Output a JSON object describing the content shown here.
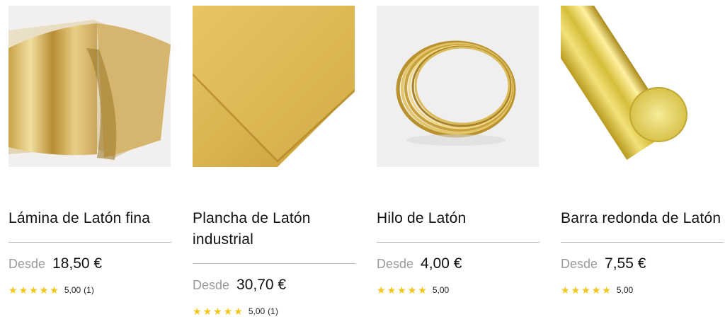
{
  "products": [
    {
      "title": "Lámina de Latón fina",
      "from": "Desde",
      "price": "18,50 €",
      "stars": 5,
      "score": "5,00",
      "count": "(1)",
      "image": "brass-foil-sheet"
    },
    {
      "title": "Plancha de Latón industrial",
      "from": "Desde",
      "price": "30,70 €",
      "stars": 5,
      "score": "5,00",
      "count": "(1)",
      "image": "brass-plate"
    },
    {
      "title": "Hilo de Latón",
      "from": "Desde",
      "price": "4,00 €",
      "stars": 5,
      "score": "5,00",
      "count": "",
      "image": "brass-wire-coil"
    },
    {
      "title": "Barra redonda de Latón",
      "from": "Desde",
      "price": "7,55 €",
      "stars": 5,
      "score": "5,00",
      "count": "",
      "image": "brass-round-bar"
    }
  ],
  "colors": {
    "star": "#f5c518",
    "muted": "#9a9a9a",
    "brass": "#d4b24a"
  }
}
